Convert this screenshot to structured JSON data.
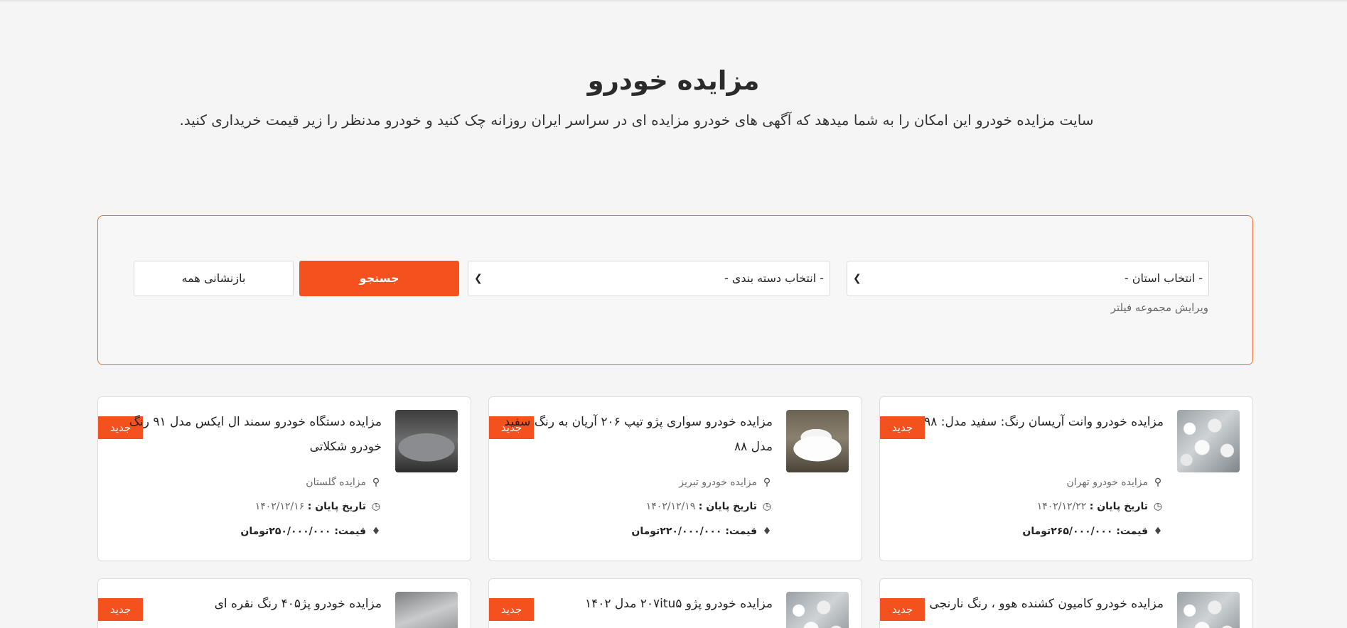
{
  "hero": {
    "title": "مزایده خودرو",
    "subtitle": "سایت مزایده خودرو این امکان را به شما میدهد که آگهی های خودرو مزایده ای در سراسر ایران روزانه چک کنید و خودرو مدنظر را زیر قیمت خریداری کنید."
  },
  "filter": {
    "province_select": "- انتخاب استان -",
    "category_select": "- انتخاب دسته بندی -",
    "search_button": "جستجو",
    "reset_button": "بازنشانی همه",
    "edit_link": "ویرایش مجموعه فیلتر"
  },
  "badge_label": "جدید",
  "labels": {
    "end_date": "تاریخ پایان :",
    "price": "قیمت:"
  },
  "cards": [
    {
      "title": "مزایده خودرو وانت آریسان رنگ: سفید مدل: ۹۸",
      "location": "مزایده خودرو تهران",
      "end_date": "۱۴۰۲/۱۲/۲۲",
      "price": "۲۶۵/۰۰۰/۰۰۰تومان",
      "thumb": "car-lot"
    },
    {
      "title": "مزایده خودرو سواری پژو تیپ ۲۰۶ آریان به رنگ سفید مدل ۸۸",
      "location": "مزایده خودرو تبریز",
      "end_date": "۱۴۰۲/۱۲/۱۹",
      "price": "۲۲۰/۰۰۰/۰۰۰تومان",
      "thumb": "white-car"
    },
    {
      "title": "مزایده دستگاه خودرو سمند ال ایکس مدل ۹۱ رنگ خودرو شکلاتی",
      "location": "مزایده گلستان",
      "end_date": "۱۴۰۲/۱۲/۱۶",
      "price": "۲۵۰/۰۰۰/۰۰۰تومان",
      "thumb": "silver-car"
    },
    {
      "title": "مزایده خودرو کامیون کشنده هوو ، رنگ نارنجی",
      "thumb": "car-lot"
    },
    {
      "title": "مزایده خودرو پژو ۲۰۷itu۵ مدل ۱۴۰۲",
      "thumb": "car-lot"
    },
    {
      "title": "مزایده خودرو پژ۴۰۵ رنگ نقره ای",
      "thumb": "grey-car"
    }
  ]
}
